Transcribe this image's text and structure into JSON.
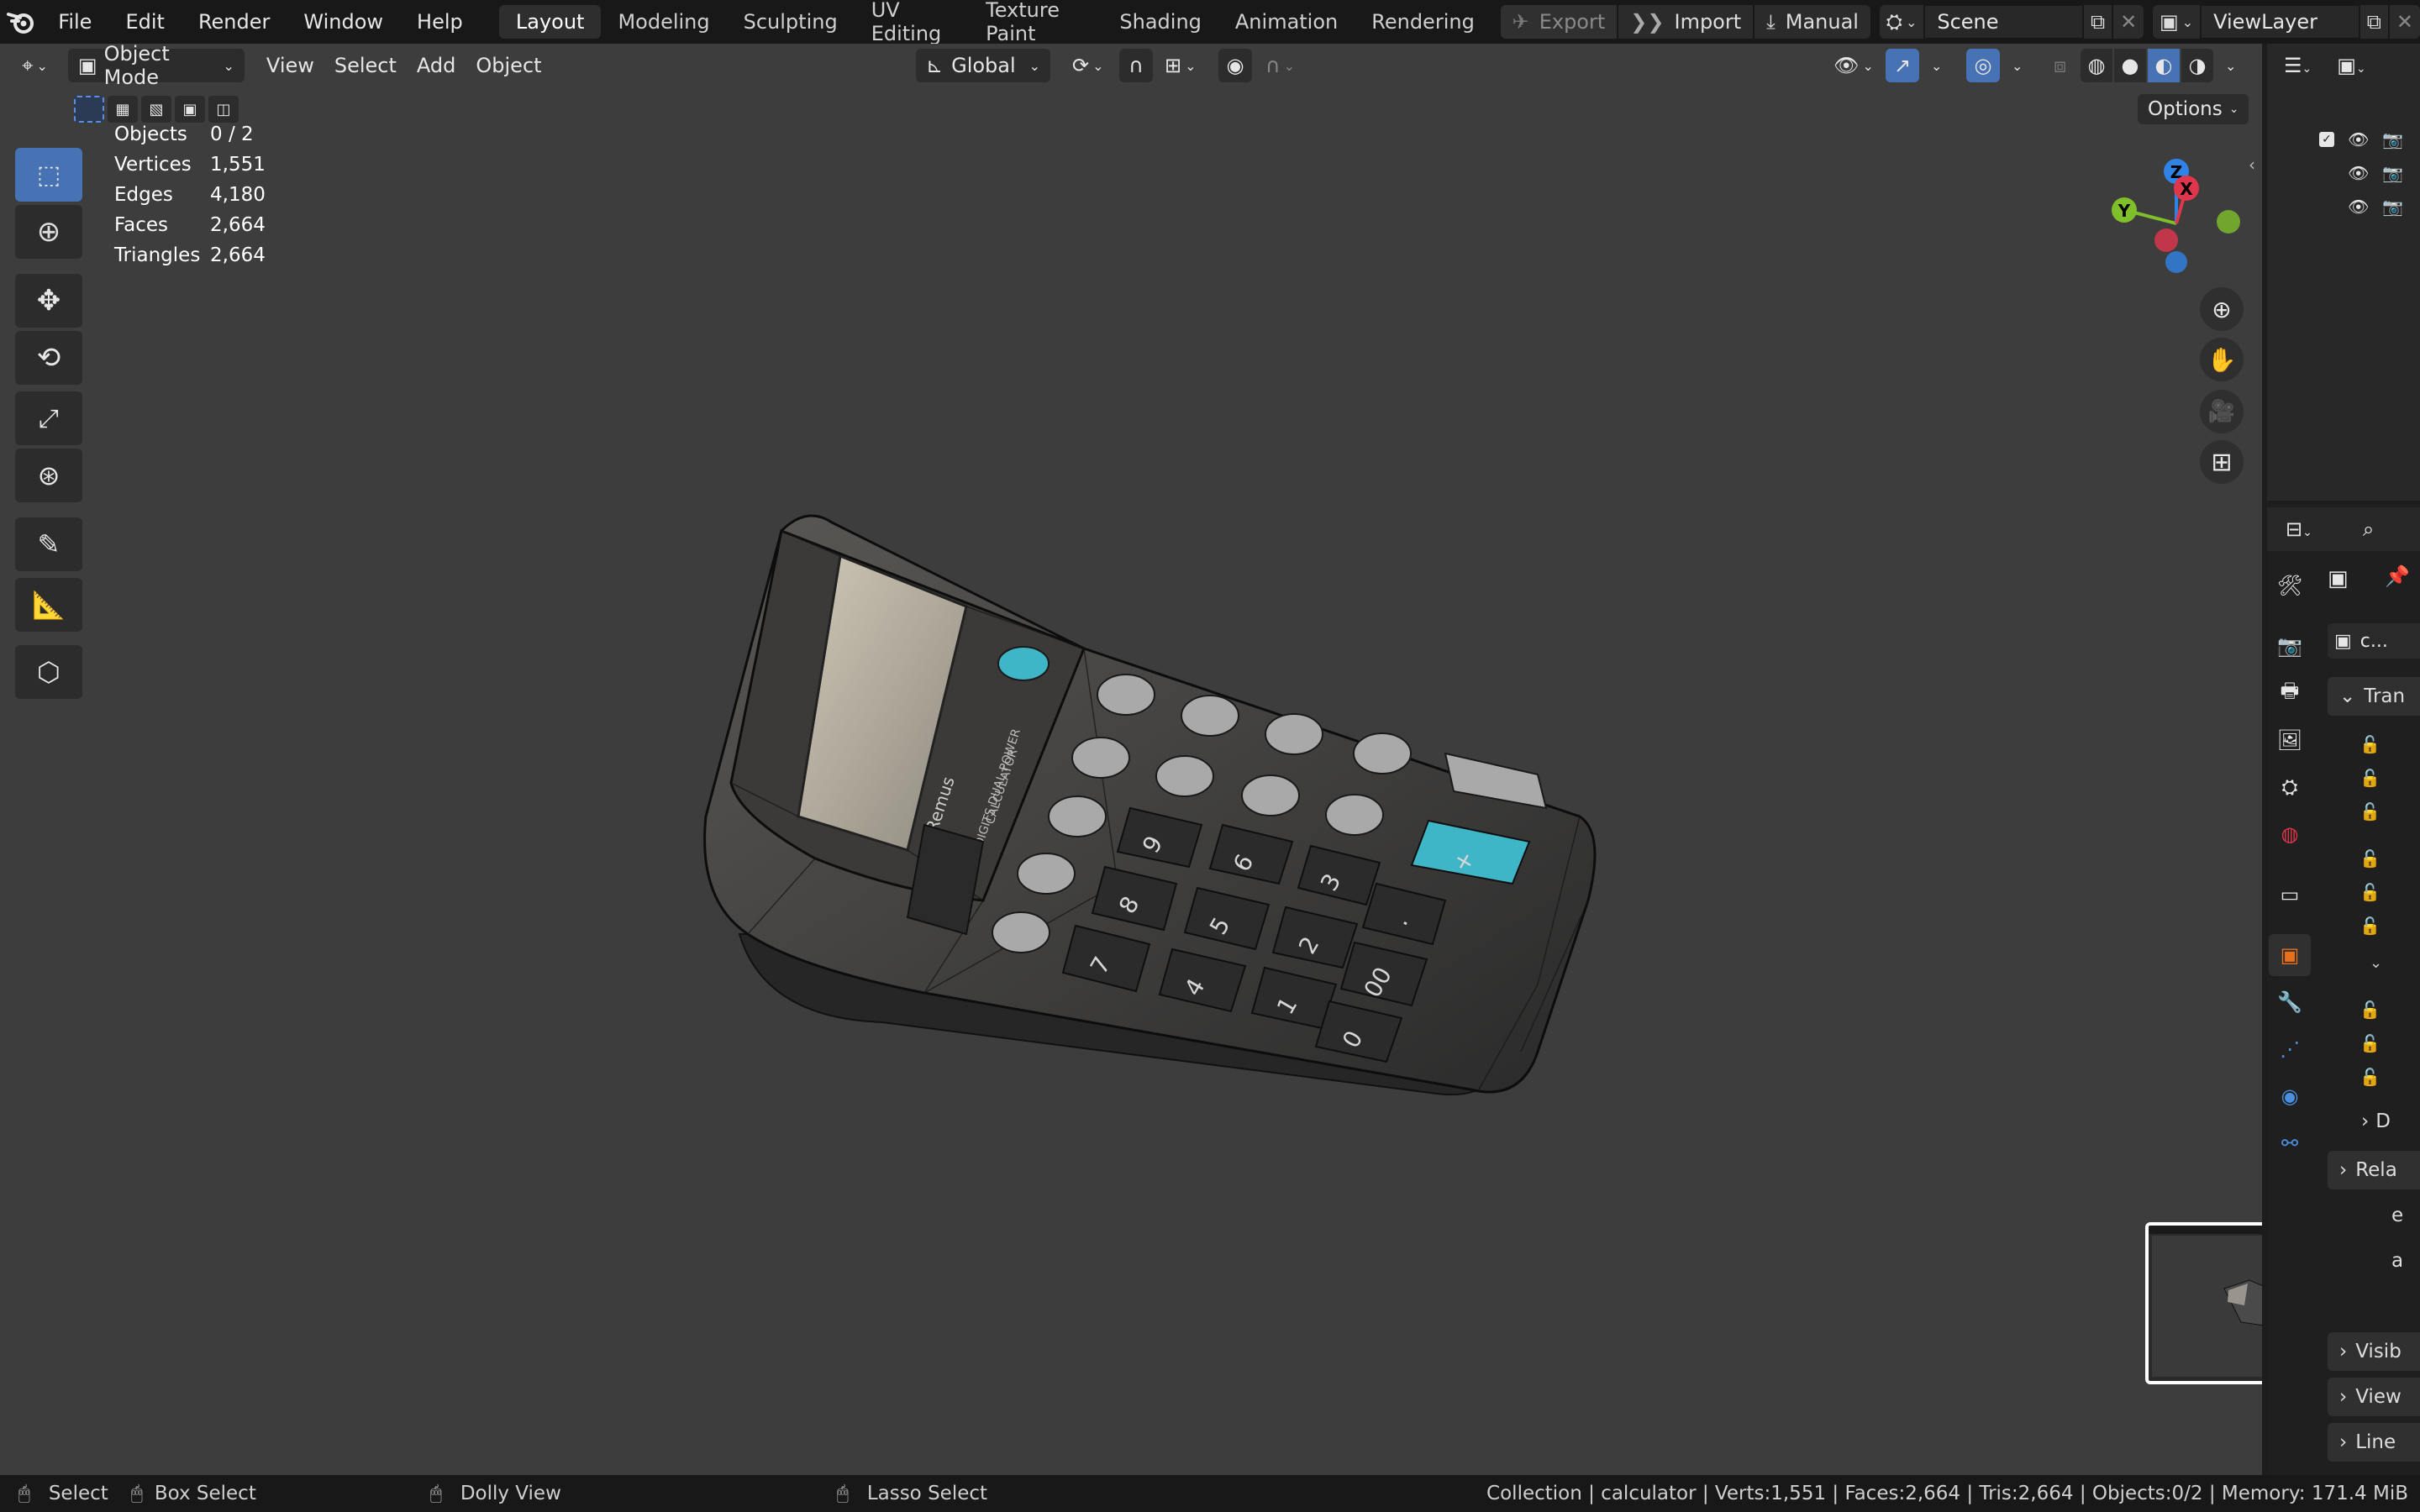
{
  "topbar": {
    "menus": [
      "File",
      "Edit",
      "Render",
      "Window",
      "Help"
    ],
    "workspaces": [
      "Layout",
      "Modeling",
      "Sculpting",
      "UV Editing",
      "Texture Paint",
      "Shading",
      "Animation",
      "Rendering"
    ],
    "active_workspace": "Layout",
    "export_label": "Export",
    "import_label": "Import",
    "manual_label": "Manual",
    "scene_value": "Scene",
    "viewlayer_value": "ViewLayer"
  },
  "viewport_header": {
    "mode": "Object Mode",
    "menus": [
      "View",
      "Select",
      "Add",
      "Object"
    ],
    "orientation": "Global",
    "options_label": "Options"
  },
  "stats": {
    "rows": [
      {
        "k": "Objects",
        "v": "0 / 2"
      },
      {
        "k": "Vertices",
        "v": "1,551"
      },
      {
        "k": "Edges",
        "v": "4,180"
      },
      {
        "k": "Faces",
        "v": "2,664"
      },
      {
        "k": "Triangles",
        "v": "2,664"
      }
    ]
  },
  "gizmo": {
    "z": "Z",
    "y": "Y",
    "x": "X"
  },
  "calculator": {
    "brand": "Remus",
    "model_text": "12 DIGITS DUAL POWER",
    "subtext": "CALCULATOR",
    "keys": [
      "9",
      "6",
      "3",
      "8",
      "5",
      "2",
      "+",
      "7",
      "4",
      "1",
      "00",
      "0",
      "."
    ]
  },
  "properties": {
    "object_name": "c...",
    "sections": [
      "Tran",
      "D",
      "Rela",
      "Visib",
      "View",
      "Line"
    ],
    "partial_labels": [
      "e",
      "a"
    ]
  },
  "statusbar": {
    "select": "Select",
    "box_select": "Box Select",
    "dolly": "Dolly View",
    "lasso": "Lasso Select",
    "info": "Collection | calculator | Verts:1,551 | Faces:2,664 | Tris:2,664 | Objects:0/2 | Memory: 171.4 MiB"
  },
  "colors": {
    "accent": "#4772b3",
    "viewport_bg": "#3d3d3d",
    "selected_orange": "#e8701a",
    "teal": "#36b8c9"
  }
}
